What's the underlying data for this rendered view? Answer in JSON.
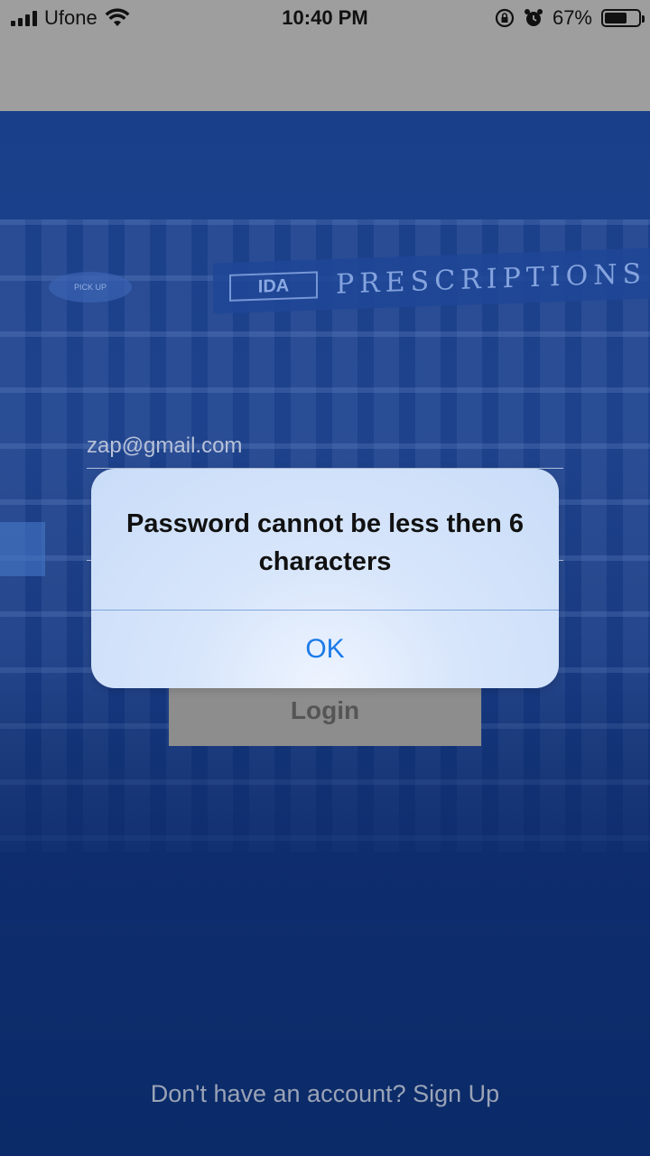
{
  "status_bar": {
    "carrier": "Ufone",
    "time": "10:40 PM",
    "battery_percent": "67%",
    "battery_level": 0.67,
    "icons": [
      "signal-icon",
      "wifi-icon",
      "rotation-lock-icon",
      "alarm-icon",
      "battery-icon"
    ]
  },
  "background": {
    "sign_logo": "IDA",
    "sign_text": "PRESCRIPTIONS",
    "pickup_text": "PICK UP"
  },
  "form": {
    "email_value": "zap@gmail.com",
    "password_value": "",
    "login_label": "Login",
    "signup_text": "Don't have an account? Sign Up"
  },
  "alert": {
    "message": "Password cannot be less then 6 characters",
    "ok_label": "OK"
  },
  "colors": {
    "accent": "#1a7ae8",
    "background": "#0d2c6e",
    "button": "#8d8d8d"
  }
}
